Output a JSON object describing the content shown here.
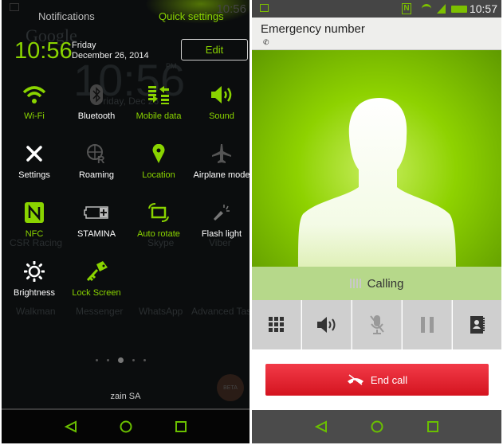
{
  "left": {
    "status_time": "10:56",
    "tab_notifications": "Notifications",
    "tab_quick_settings": "Quick settings",
    "clock_time": "10:56",
    "clock_day": "Friday",
    "clock_date": "December 26, 2014",
    "edit_label": "Edit",
    "tiles": [
      {
        "label": "Wi-Fi",
        "icon": "wifi-icon",
        "active": true
      },
      {
        "label": "Bluetooth",
        "icon": "bluetooth-icon",
        "active": false
      },
      {
        "label": "Mobile data",
        "icon": "mobile-data-icon",
        "active": true
      },
      {
        "label": "Sound",
        "icon": "sound-icon",
        "active": true
      },
      {
        "label": "Settings",
        "icon": "settings-icon",
        "active": false
      },
      {
        "label": "Roaming",
        "icon": "roaming-icon",
        "active": false
      },
      {
        "label": "Location",
        "icon": "location-icon",
        "active": true
      },
      {
        "label": "Airplane mode",
        "icon": "airplane-icon",
        "active": false
      },
      {
        "label": "NFC",
        "icon": "nfc-icon",
        "active": true
      },
      {
        "label": "STAMINA",
        "icon": "battery-stamina-icon",
        "active": false
      },
      {
        "label": "Auto rotate",
        "icon": "auto-rotate-icon",
        "active": true
      },
      {
        "label": "Flash light",
        "icon": "flashlight-icon",
        "active": false
      },
      {
        "label": "Brightness",
        "icon": "brightness-icon",
        "active": false
      },
      {
        "label": "Lock Screen",
        "icon": "key-icon",
        "active": true
      }
    ],
    "background": {
      "google": "Google",
      "big_time": "10:56",
      "pm": "PM",
      "big_date": "Friday, Dec 26",
      "apps": [
        "CSR Racing",
        "Skype",
        "Viber",
        "Walkman",
        "Messenger",
        "WhatsApp",
        "Advanced Task"
      ],
      "beta": "BETA"
    },
    "carrier": "zain SA"
  },
  "right": {
    "status_time": "10:57",
    "title": "Emergency number",
    "status": "Calling",
    "buttons": [
      "dialpad-icon",
      "speaker-icon",
      "mute-icon",
      "hold-icon",
      "contacts-icon"
    ],
    "end_call_label": "End call"
  },
  "colors": {
    "accent": "#8ad400",
    "end_call": "#e0202c",
    "call_green": "#7cc000"
  }
}
